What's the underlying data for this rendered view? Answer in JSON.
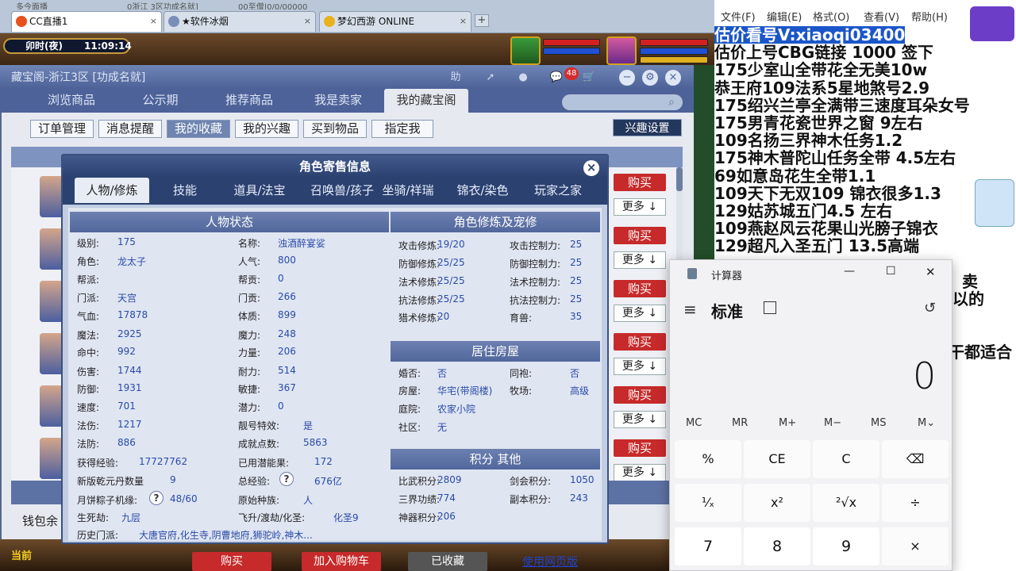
{
  "browser": {
    "tabs": [
      {
        "label": "CC直播1",
        "close": "×"
      },
      {
        "label": "★软件冰烟",
        "close": "×"
      },
      {
        "label": "梦幻西游 ONLINE",
        "close": "×"
      }
    ],
    "new_tab": "+",
    "url_fragments": [
      "多今面播",
      "0浙江 3区功成名就]",
      "00至僧|0/0/00000"
    ]
  },
  "game": {
    "clock_period": "卯时(夜)",
    "clock_time": "11:09:14"
  },
  "cbg": {
    "title": "藏宝阁-浙江3区 [功成名就]",
    "header_icons": {
      "help": "助",
      "cart_count": "48"
    },
    "nav_tabs": [
      "浏览商品",
      "公示期",
      "推荐商品",
      "我是卖家",
      "我的藏宝阁"
    ],
    "sub_buttons": [
      "订单管理",
      "消息提醒",
      "我的收藏",
      "我的兴趣",
      "买到物品",
      "指定我"
    ],
    "interest_settings": "兴趣设置",
    "buy_label": "购买",
    "more_label": "更多 ↓",
    "balance_label": "钱包余",
    "current_label": "当前",
    "bottom_buttons": [
      "购买",
      "加入购物车",
      "已收藏"
    ],
    "web_version": "使用网页版"
  },
  "dialog": {
    "title": "角色寄售信息",
    "close": "×",
    "tabs": [
      "人物/修炼",
      "技能",
      "道具/法宝",
      "召唤兽/孩子",
      "坐骑/祥瑞",
      "锦衣/染色",
      "玩家之家"
    ],
    "char_header": "人物状态",
    "char_left": [
      [
        "级别:",
        "175"
      ],
      [
        "角色:",
        "龙太子"
      ],
      [
        "帮派:",
        ""
      ],
      [
        "门派:",
        "天宫"
      ],
      [
        "气血:",
        "17878"
      ],
      [
        "魔法:",
        "2925"
      ],
      [
        "命中:",
        "992"
      ],
      [
        "伤害:",
        "1744"
      ],
      [
        "防御:",
        "1931"
      ],
      [
        "速度:",
        "701"
      ],
      [
        "法伤:",
        "1217"
      ],
      [
        "法防:",
        "886"
      ]
    ],
    "char_right": [
      [
        "名称:",
        "浊酒醉宴娑"
      ],
      [
        "人气:",
        "800"
      ],
      [
        "帮贡:",
        "0"
      ],
      [
        "门贡:",
        "266"
      ],
      [
        "体质:",
        "899"
      ],
      [
        "魔力:",
        "248"
      ],
      [
        "力量:",
        "206"
      ],
      [
        "耐力:",
        "514"
      ],
      [
        "敏捷:",
        "367"
      ],
      [
        "潜力:",
        "0"
      ],
      [
        "靓号特效:",
        "是"
      ],
      [
        "成就点数:",
        "5863"
      ]
    ],
    "extra_rows": {
      "exp_label": "获得经验:",
      "exp_value": "17727762",
      "used_pot_label": "已用潜能果:",
      "used_pot_value": "172",
      "qianyuan_label": "新版乾元丹数量",
      "qianyuan_value": "9",
      "total_exp_label": "总经验:",
      "total_exp_value": "676亿",
      "mooncake_label": "月饼粽子机缘:",
      "mooncake_value": "48/60",
      "race_label": "原始种族:",
      "race_value": "人",
      "life_label": "生死劫:",
      "life_value": "九层",
      "fly_label": "飞升/渡劫/化圣:",
      "fly_value": "化圣9",
      "history_label": "历史门派:",
      "history_value": "大唐官府,化生寺,阴曹地府,狮驼岭,神木..."
    },
    "train_header": "角色修炼及宠修",
    "train_rows": [
      [
        "攻击修炼:",
        "19/20",
        "攻击控制力:",
        "25"
      ],
      [
        "防御修炼:",
        "25/25",
        "防御控制力:",
        "25"
      ],
      [
        "法术修炼:",
        "25/25",
        "法术控制力:",
        "25"
      ],
      [
        "抗法修炼:",
        "25/25",
        "抗法控制力:",
        "25"
      ],
      [
        "猎术修炼:",
        "20",
        "育兽:",
        "35"
      ]
    ],
    "house_header": "居住房屋",
    "house_rows": [
      [
        "婚否:",
        "否",
        "同袍:",
        "否"
      ],
      [
        "房屋:",
        "华宅(带阁楼)",
        "牧场:",
        "高级"
      ],
      [
        "庭院:",
        "农家小院",
        "",
        ""
      ],
      [
        "社区:",
        "无",
        "",
        ""
      ]
    ],
    "score_header": "积分 其他",
    "score_rows": [
      [
        "比武积分:",
        "2809",
        "剑会积分:",
        "1050"
      ],
      [
        "三界功绩:",
        "774",
        "副本积分:",
        "243"
      ],
      [
        "神器积分:",
        "206",
        "",
        ""
      ]
    ],
    "help_mark": "?"
  },
  "notepad": {
    "menu": [
      "文件(F)",
      "编辑(E)",
      "格式(O)",
      "查看(V)",
      "帮助(H)"
    ],
    "lines": [
      "估价看号V:xiaoqi03400",
      "估价上号CBG链接 1000 签下",
      "175少室山全带花全无美10w",
      "恭王府109法系5星地煞号2.9",
      "175绍兴兰亭全满带三速度耳朵女号",
      "175男青花瓷世界之窗  9左右",
      "109名扬三界神木任务1.2",
      "175神木普陀山任务全带 4.5左右",
      "69如意岛花生全带1.1",
      "109天下无双109  锦衣很多1.3",
      "129姑苏城五门4.5 左右",
      "109燕赵风云花果山光膀子锦衣",
      "129超凡入圣五门  13.5高端",
      "",
      "卖",
      "以的",
      "",
      "",
      "干都适合"
    ]
  },
  "calculator": {
    "title": "计算器",
    "mode": "标准",
    "display": "0",
    "memory": [
      "MC",
      "MR",
      "M+",
      "M−",
      "MS",
      "M⌄"
    ],
    "keys": [
      "%",
      "CE",
      "C",
      "⌫",
      "¹⁄ₓ",
      "x²",
      "²√x",
      "÷",
      "7",
      "8",
      "9",
      "×"
    ],
    "win_controls": [
      "—",
      "☐",
      "✕"
    ]
  },
  "colors": {
    "accent": "#4d6298",
    "buy": "#c72a2a",
    "link": "#2a4aa8",
    "selection": "#1a56c8"
  }
}
